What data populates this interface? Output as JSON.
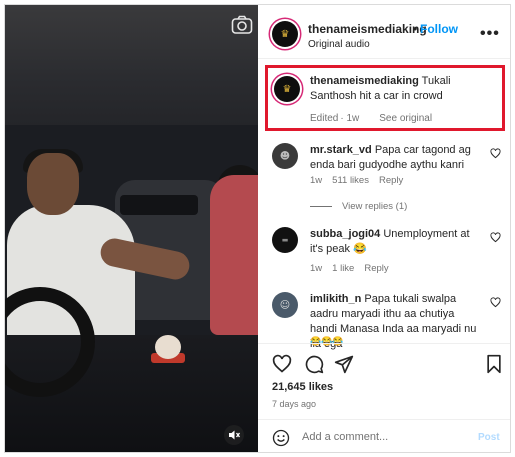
{
  "header": {
    "username": "thenameismediaking",
    "separator": "•",
    "follow_label": "Follow",
    "subtitle": "Original audio",
    "more_icon": "more-options-icon",
    "more_label": "•••"
  },
  "caption": {
    "username": "thenameismediaking",
    "text": " Tukali Santhosh hit a car in crowd",
    "edited": "Edited",
    "age": "· 1w",
    "see_original": "See original"
  },
  "comments": [
    {
      "username": "mr.stark_vd",
      "text": " Papa car tagond ag enda bari gudyodhe aythu kanri",
      "age": "1w",
      "likes": "511 likes",
      "reply": "Reply",
      "view_replies": "View replies (1)"
    },
    {
      "username": "subba_jogi04",
      "text": " Unemployment at it's peak 😂",
      "age": "1w",
      "likes": "1 like",
      "reply": "Reply"
    },
    {
      "username": "imlikith_n",
      "text": " Papa tukali swalpa aadru maryadi ithu aa chutiya handi Manasa Inda aa maryadi nu ila ega",
      "emojis": "😂😂😂"
    }
  ],
  "stats": {
    "likes": "21,645 likes",
    "posted": "7 days ago"
  },
  "composer": {
    "placeholder": "Add a comment...",
    "post_label": "Post"
  },
  "colors": {
    "follow": "#0095f6",
    "highlight_border": "#e0182d",
    "muted_text": "#737373",
    "post_disabled": "#b3dbff"
  }
}
